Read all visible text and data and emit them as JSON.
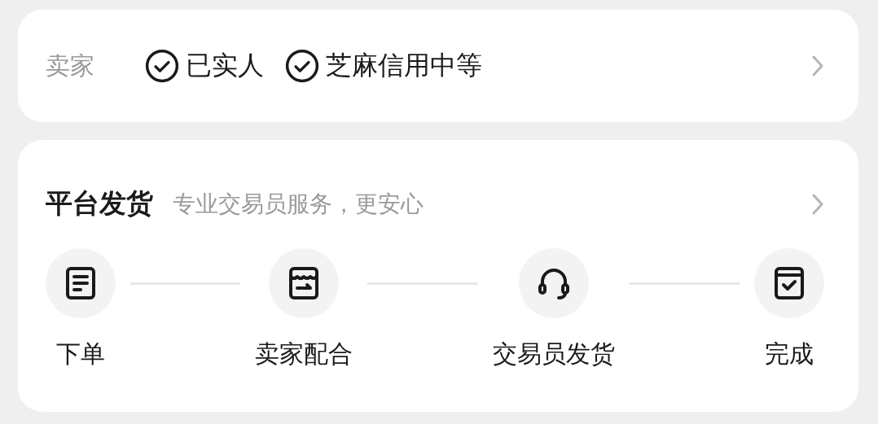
{
  "seller": {
    "label": "卖家",
    "badges": [
      "已实人",
      "芝麻信用中等"
    ]
  },
  "platform_shipping": {
    "title": "平台发货",
    "subtitle": "专业交易员服务，更安心",
    "steps": [
      {
        "kind": "document",
        "label": "下单"
      },
      {
        "kind": "store",
        "label": "卖家配合"
      },
      {
        "kind": "headset",
        "label": "交易员发货"
      },
      {
        "kind": "package",
        "label": "完成"
      }
    ]
  }
}
